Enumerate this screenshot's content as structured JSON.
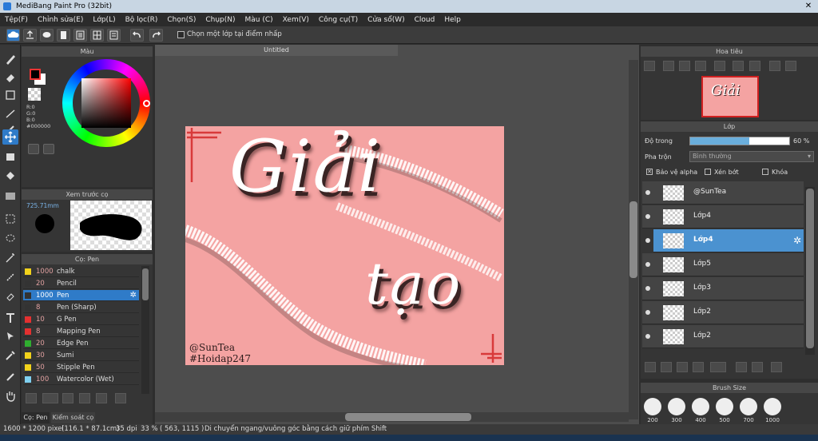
{
  "window": {
    "title": "MediBang Paint Pro (32bit)",
    "close": "✕"
  },
  "menu": [
    "Tệp(F)",
    "Chỉnh sửa(E)",
    "Lớp(L)",
    "Bộ lọc(R)",
    "Chọn(S)",
    "Chụp(N)",
    "Màu (C)",
    "Xem(V)",
    "Công cụ(T)",
    "Cửa sổ(W)",
    "Cloud",
    "Help"
  ],
  "toolbar": {
    "checkbox_label": "Chọn một lớp tại điểm nhấp"
  },
  "color_panel": {
    "title": "Màu",
    "r": "R:0",
    "g": "G:0",
    "b": "B:0",
    "hex": "#000000"
  },
  "brush_preview": {
    "title": "Xem trước cọ",
    "size": "725.71mm"
  },
  "brush_panel": {
    "title": "Cọ: Pen",
    "items": [
      {
        "size": "1000",
        "name": "chalk",
        "color": "#f2d21b"
      },
      {
        "size": "20",
        "name": "Pencil",
        "color": "#333333"
      },
      {
        "size": "1000",
        "name": "Pen",
        "color": "#333333"
      },
      {
        "size": "8",
        "name": "Pen (Sharp)",
        "color": "#333333"
      },
      {
        "size": "10",
        "name": "G Pen",
        "color": "#e43030"
      },
      {
        "size": "8",
        "name": "Mapping Pen",
        "color": "#e43030"
      },
      {
        "size": "20",
        "name": "Edge Pen",
        "color": "#2fae2f"
      },
      {
        "size": "30",
        "name": "Sumi",
        "color": "#f2d21b"
      },
      {
        "size": "50",
        "name": "Stipple Pen",
        "color": "#f2d21b"
      },
      {
        "size": "100",
        "name": "Watercolor (Wet)",
        "color": "#7fd0f0"
      }
    ],
    "tab1": "Cọ: Pen",
    "tab2": "Kiểm soát cọ"
  },
  "canvas": {
    "tab": "Untitled",
    "text1": "Giải",
    "text2": "tạo",
    "watermark1": "@SunTea",
    "watermark2": "#Hoidap247"
  },
  "navigator": {
    "title": "Hoa tiêu"
  },
  "layers": {
    "title": "Lớp",
    "opacity_label": "Độ trong",
    "opacity_value": "60 %",
    "opacity": 0.6,
    "blend_label": "Pha trộn",
    "blend_value": "Bình thường",
    "protect_alpha": "Bảo vệ alpha",
    "clipping": "Xén bớt",
    "lock": "Khóa",
    "items": [
      "@SunTea",
      "Lớp4",
      "Lớp4",
      "Lớp5",
      "Lớp3",
      "Lớp2",
      "Lớp2"
    ],
    "selected_index": 2
  },
  "brush_size": {
    "title": "Brush Size",
    "sizes": [
      "200",
      "300",
      "400",
      "500",
      "700",
      "1000"
    ]
  },
  "status": {
    "dims": "1600 * 1200 pixel",
    "cm": "(116.1 * 87.1cm)",
    "dpi": "35 dpi",
    "zoom": "33 %",
    "coords": "( 563, 1115 )",
    "hint": "Di chuyển ngang/vuông góc bằng cách giữ phím Shift"
  }
}
